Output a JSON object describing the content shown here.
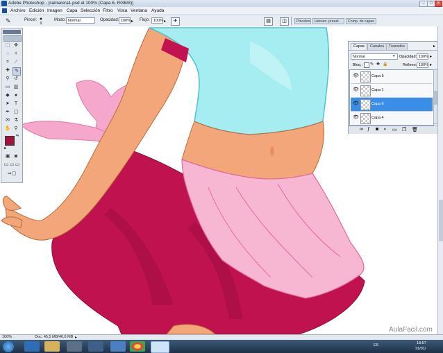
{
  "window": {
    "title": "Adobe Photoshop - [camarera1.psd al 100% (Capa 6, RGB/8)]",
    "min_label": "–",
    "max_label": "□",
    "close_label": "✕"
  },
  "menu": [
    "Archivo",
    "Edición",
    "Imagen",
    "Capa",
    "Selección",
    "Filtro",
    "Vista",
    "Ventana",
    "Ayuda"
  ],
  "options": {
    "tool_name": "Pincel:",
    "brush_size": "9",
    "mode_label": "Modo:",
    "mode_value": "Normal",
    "opacity_label": "Opacidad:",
    "opacity_value": "100%",
    "flow_label": "Flujo:",
    "flow_value": "100%",
    "palette_tabs": [
      "Pinceles",
      "Herram. preest.",
      "Comp. de capas"
    ]
  },
  "colors": {
    "foreground": "#a0143a",
    "background": "#000000",
    "selection": "#3a8ee6",
    "skirt": "#c0124f",
    "apron": "#f4a7c8",
    "shirt": "#a5edf0",
    "skin": "#f2a679"
  },
  "layers_panel": {
    "tabs": [
      "Capas",
      "Canales",
      "Trazados"
    ],
    "blend_mode": "Normal",
    "opacity_label": "Opacidad:",
    "opacity_value": "100%",
    "lock_label": "Bloq.:",
    "fill_label": "Relleno:",
    "fill_value": "100%",
    "layers": [
      {
        "name": "Capa 5",
        "visible": true,
        "selected": false
      },
      {
        "name": "Capa 1",
        "visible": true,
        "selected": false
      },
      {
        "name": "Capa 6",
        "visible": true,
        "selected": true
      },
      {
        "name": "Capa 4",
        "visible": true,
        "selected": false
      }
    ]
  },
  "status": {
    "zoom": "100%",
    "doc": "Doc: 45,5 MB/46,6 MB"
  },
  "taskbar": {
    "language": "ES",
    "time": "18:57",
    "date": "31/01/"
  },
  "watermark": "AulaFacil.com"
}
